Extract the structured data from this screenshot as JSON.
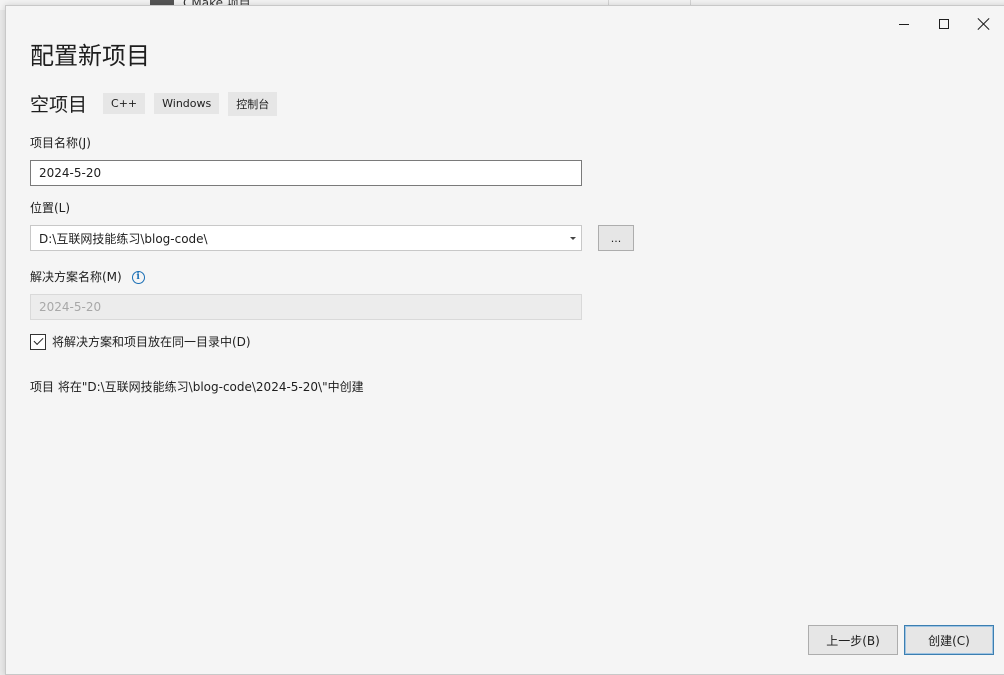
{
  "background": {
    "strip_text": "CMake 项目"
  },
  "window_controls": {
    "minimize": "minimize",
    "maximize": "maximize",
    "close": "close"
  },
  "header": {
    "title": "配置新项目"
  },
  "template": {
    "name": "空项目",
    "tags": [
      "C++",
      "Windows",
      "控制台"
    ]
  },
  "form": {
    "project_name_label": "项目名称(J)",
    "project_name_value": "2024-5-20",
    "location_label": "位置(L)",
    "location_value": "D:\\互联网技能练习\\blog-code\\",
    "browse_label": "...",
    "solution_name_label": "解决方案名称(M)",
    "solution_name_value": "2024-5-20",
    "same_dir_label": "将解决方案和项目放在同一目录中(D)",
    "same_dir_checked": true,
    "path_note": "项目 将在\"D:\\互联网技能练习\\blog-code\\2024-5-20\\\"中创建"
  },
  "footer": {
    "back_label": "上一步(B)",
    "create_label": "创建(C)"
  },
  "colors": {
    "dialog_bg": "#f5f5f5",
    "accent_border": "#3c7fb1",
    "info_icon": "#1a6fb5"
  }
}
